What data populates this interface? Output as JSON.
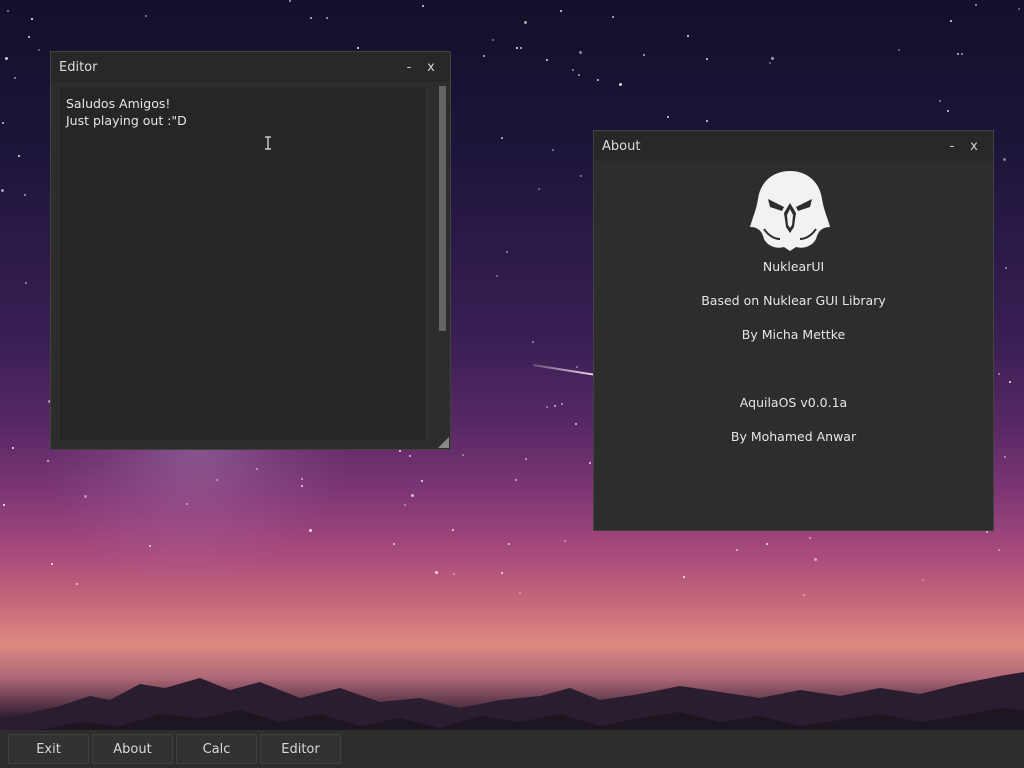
{
  "editor": {
    "title": "Editor",
    "minimize": "-",
    "close": "x",
    "content": "Saludos Amigos!\nJust playing out :\"D"
  },
  "about": {
    "title": "About",
    "minimize": "-",
    "close": "x",
    "app_name": "NuklearUI",
    "based_on": "Based on Nuklear GUI Library",
    "author": "By Micha Mettke",
    "os_version": "AquilaOS v0.0.1a",
    "os_author": "By Mohamed Anwar"
  },
  "taskbar": {
    "buttons": [
      "Exit",
      "About",
      "Calc",
      "Editor"
    ]
  },
  "colors": {
    "window_bg": "#2d2d2d",
    "titlebar_bg": "#282828",
    "text": "#e6e6e6"
  }
}
